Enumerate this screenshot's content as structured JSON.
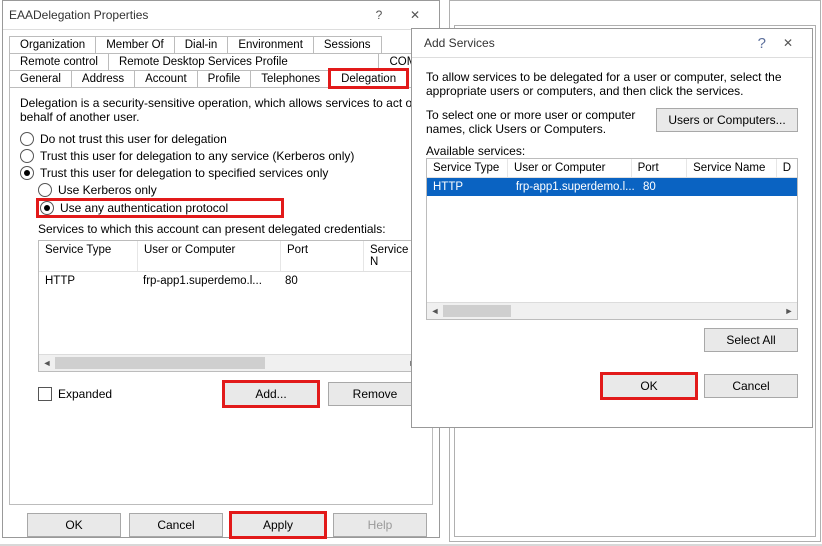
{
  "properties": {
    "title": "EAADelegation Properties",
    "tabs_rows": [
      [
        "Organization",
        "Member Of",
        "Dial-in",
        "Environment",
        "Sessions"
      ],
      [
        "Remote control",
        "Remote Desktop Services Profile",
        "COM+"
      ],
      [
        "General",
        "Address",
        "Account",
        "Profile",
        "Telephones",
        "Delegation"
      ]
    ],
    "active_tab": "Delegation",
    "intro": "Delegation is a security-sensitive operation, which allows services to act on behalf of another user.",
    "radios": {
      "no_trust": "Do not trust this user for delegation",
      "any_service": "Trust this user for delegation to any service (Kerberos only)",
      "specified": "Trust this user for delegation to specified services only",
      "kerberos_only": "Use Kerberos only",
      "any_auth": "Use any authentication protocol"
    },
    "services_label": "Services to which this account can present delegated credentials:",
    "table": {
      "headers": [
        "Service Type",
        "User or Computer",
        "Port",
        "Service N"
      ],
      "row": {
        "type": "HTTP",
        "host": "frp-app1.superdemo.l...",
        "port": "80",
        "name": ""
      }
    },
    "expanded_label": "Expanded",
    "add_label": "Add...",
    "remove_label": "Remove",
    "ok_label": "OK",
    "cancel_label": "Cancel",
    "apply_label": "Apply",
    "help_label": "Help"
  },
  "addServices": {
    "title": "Add Services",
    "instr1": "To allow services to be delegated for a user or computer, select the appropriate users or computers, and then click the services.",
    "instr2": "To select one or more user or computer names, click Users or Computers.",
    "users_btn": "Users or Computers...",
    "available_label": "Available services:",
    "table": {
      "headers": [
        "Service Type",
        "User or Computer",
        "Port",
        "Service Name",
        "D"
      ],
      "row": {
        "type": "HTTP",
        "host": "frp-app1.superdemo.l...",
        "port": "80",
        "name": "",
        "d": ""
      }
    },
    "select_all_label": "Select All",
    "ok_label": "OK",
    "cancel_label": "Cancel"
  }
}
